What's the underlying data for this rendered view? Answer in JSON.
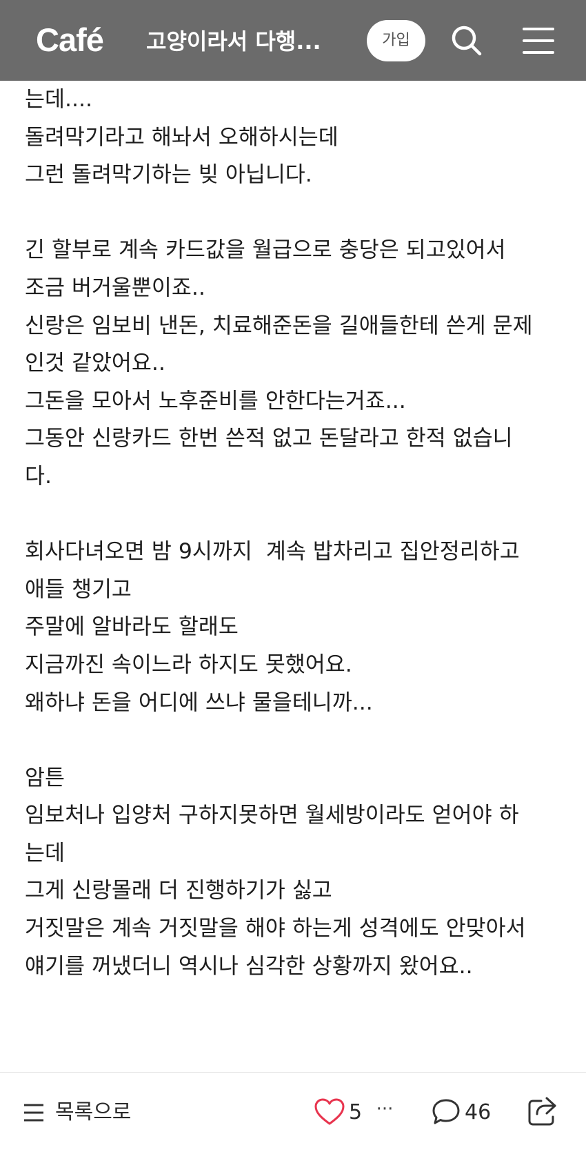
{
  "header": {
    "logo": "Café",
    "cafe_title": "고양이라서 다행...",
    "join_label": "가입",
    "search_icon": "search-icon",
    "menu_icon": "hamburger-menu-icon",
    "background": "#6b6b6b"
  },
  "post": {
    "lines": [
      "는데....",
      "돌려막기라고 해놔서 오해하시는데",
      "그런 돌려막기하는 빚 아닙니다.",
      "",
      "긴 할부로 계속 카드값을 월급으로 충당은 되고있어서",
      "조금 버거울뿐이죠..",
      "신랑은 임보비 낸돈, 치료해준돈을 길애들한테 쓴게 문제",
      "인것 같았어요..",
      "그돈을 모아서 노후준비를 안한다는거죠...",
      "그동안 신랑카드 한번 쓴적 없고 돈달라고 한적 없습니",
      "다.",
      "",
      "회사다녀오면 밤 9시까지  계속 밥차리고 집안정리하고",
      "애들 챙기고",
      "주말에 알바라도 할래도",
      "지금까진 속이느라 하지도 못했어요.",
      "왜하냐 돈을 어디에 쓰냐 물을테니까...",
      "",
      "암튼",
      "임보처나 입양처 구하지못하면 월세방이라도 얻어야 하",
      "는데",
      "그게 신랑몰래 더 진행하기가 싫고",
      "거짓말은 계속 거짓말을 해야 하는게 성격에도 안맞아서",
      "얘기를 꺼냈더니 역시나 심각한 상황까지 왔어요.."
    ]
  },
  "bottom_bar": {
    "list_label": "목록으로",
    "like_count": "5",
    "more_label": "···",
    "comment_count": "46",
    "like_color": "#e8344e"
  }
}
